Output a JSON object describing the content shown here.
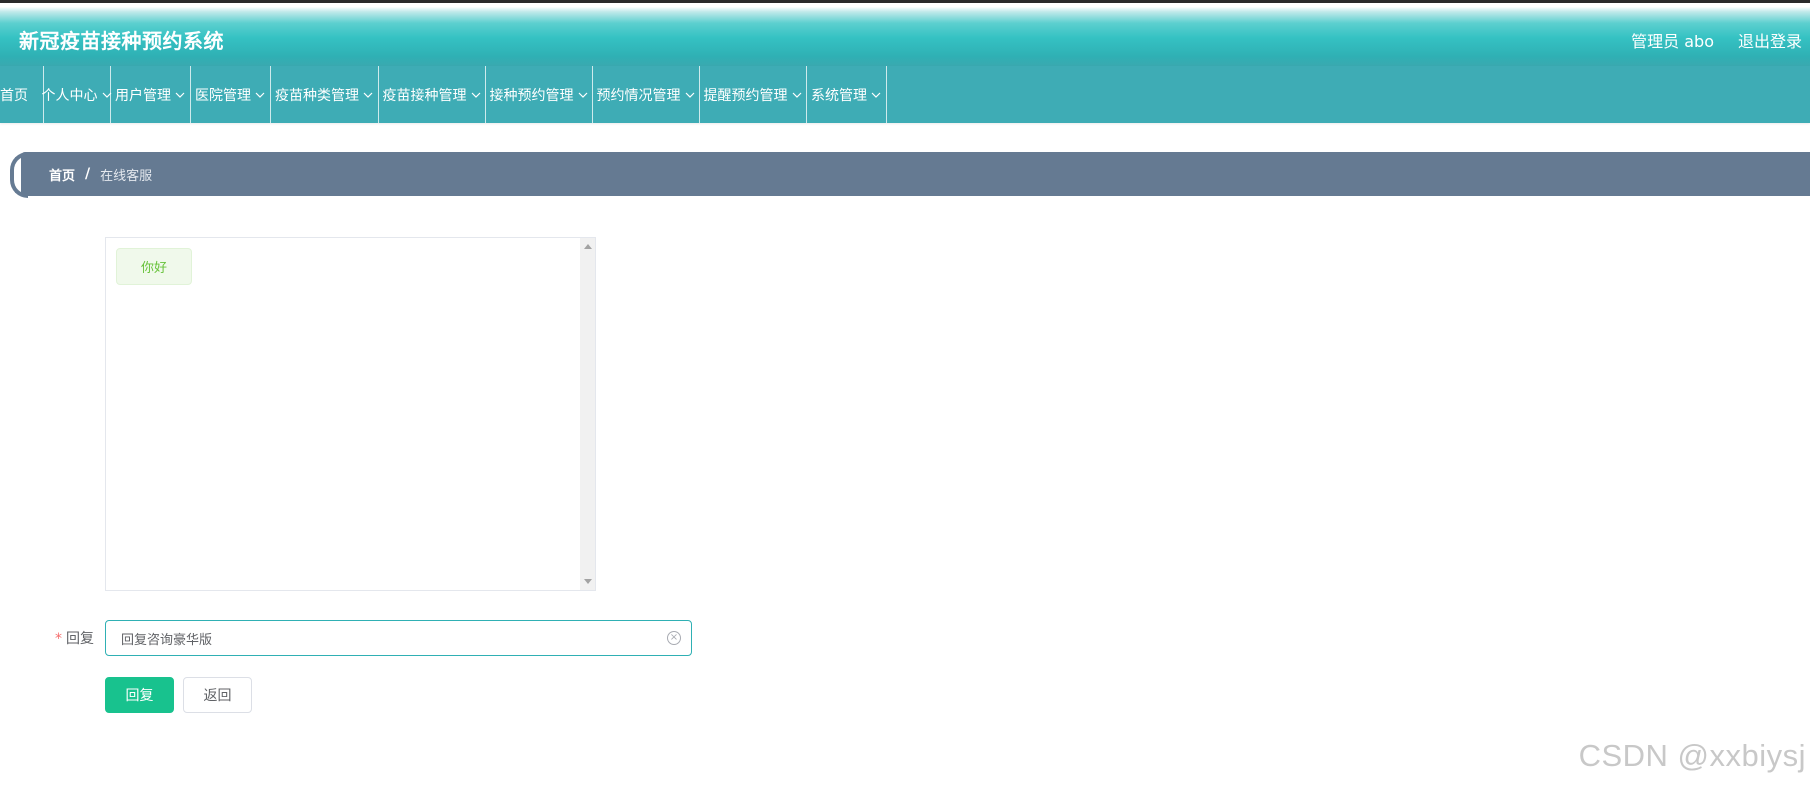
{
  "header": {
    "title": "新冠疫苗接种预约系统",
    "user_label": "管理员 abo",
    "logout_label": "退出登录"
  },
  "nav": {
    "items": [
      {
        "label": "首页"
      },
      {
        "label": "个人中心"
      },
      {
        "label": "用户管理"
      },
      {
        "label": "医院管理"
      },
      {
        "label": "疫苗种类管理"
      },
      {
        "label": "疫苗接种管理"
      },
      {
        "label": "接种预约管理"
      },
      {
        "label": "预约情况管理"
      },
      {
        "label": "提醒预约管理"
      },
      {
        "label": "系统管理"
      }
    ],
    "chevron_icon": "chevron-down-icon"
  },
  "breadcrumb": {
    "home": "首页",
    "separator": "/",
    "current": "在线客服"
  },
  "chat": {
    "messages": [
      {
        "text": "你好"
      }
    ]
  },
  "reply": {
    "label": "回复",
    "required_mark": "*",
    "value": "回复咨询豪华版",
    "clear_icon": "circle-close-icon"
  },
  "buttons": {
    "reply_label": "回复",
    "back_label": "返回"
  },
  "watermark": "CSDN @xxbiysj",
  "colors": {
    "header_teal": "#35c2c3",
    "nav_bg": "#3eacb5",
    "breadcrumb_bg": "#657a92",
    "primary_button": "#18c28e",
    "message_text": "#67c23a"
  }
}
